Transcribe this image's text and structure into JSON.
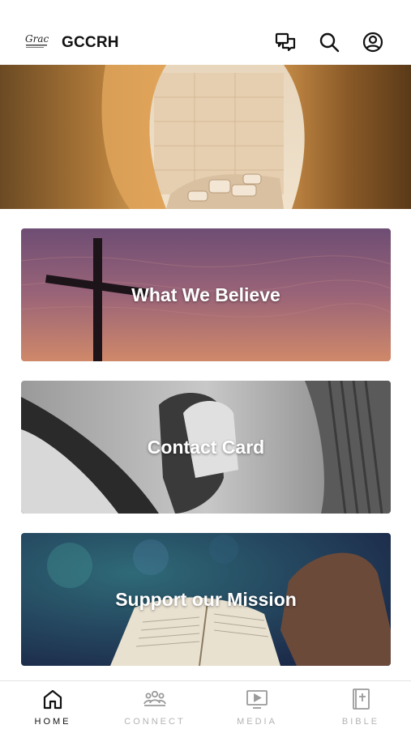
{
  "header": {
    "logo_text": "Grac",
    "title": "GCCRH",
    "icons": [
      "chat-icon",
      "search-icon",
      "account-icon"
    ]
  },
  "hero": {
    "image": "empty-tomb"
  },
  "cards": [
    {
      "label": "What We Believe",
      "image": "cross-sunset"
    },
    {
      "label": "Contact Card",
      "image": "clasped-hands"
    },
    {
      "label": "Support our Mission",
      "image": "open-bible"
    }
  ],
  "tabs": [
    {
      "label": "HOME",
      "icon": "home-icon",
      "active": true
    },
    {
      "label": "CONNECT",
      "icon": "people-icon",
      "active": false
    },
    {
      "label": "MEDIA",
      "icon": "play-icon",
      "active": false
    },
    {
      "label": "BIBLE",
      "icon": "bible-icon",
      "active": false
    }
  ],
  "colors": {
    "active_tab": "#111111",
    "inactive_tab": "#b3b3b3",
    "card_text": "#ffffff"
  }
}
